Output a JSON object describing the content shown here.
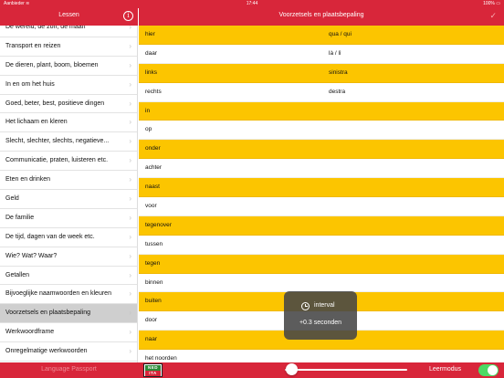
{
  "statusbar": {
    "carrier": "Aanbieder ≋",
    "time": "17:44",
    "battery": "100% ▭"
  },
  "sidebar": {
    "title": "Lessen",
    "info_icon": "info-icon",
    "items": [
      {
        "label": "De wereld, de zon, de maan",
        "active": false
      },
      {
        "label": "Transport en reizen",
        "active": false
      },
      {
        "label": "De dieren, plant, boom, bloemen",
        "active": false
      },
      {
        "label": "In en om het huis",
        "active": false
      },
      {
        "label": "Goed, beter, best, positieve dingen",
        "active": false
      },
      {
        "label": "Het lichaam en kleren",
        "active": false
      },
      {
        "label": "Slecht, slechter, slechts, negatieve...",
        "active": false
      },
      {
        "label": "Communicatie, praten, luisteren etc.",
        "active": false
      },
      {
        "label": "Eten en drinken",
        "active": false
      },
      {
        "label": "Geld",
        "active": false
      },
      {
        "label": "De familie",
        "active": false
      },
      {
        "label": "De tijd, dagen van de week etc.",
        "active": false
      },
      {
        "label": "Wie? Wat? Waar?",
        "active": false
      },
      {
        "label": "Getallen",
        "active": false
      },
      {
        "label": "Bijvoeglijke naamwoorden en kleuren",
        "active": false
      },
      {
        "label": "Voorzetsels en plaatsbepaling",
        "active": true
      },
      {
        "label": "Werkwoordframe",
        "active": false
      },
      {
        "label": "Onregelmatige werkwoorden",
        "active": false
      }
    ],
    "chevron": "›",
    "footer_link": "Language Passport"
  },
  "main": {
    "title": "Voorzetsels en plaatsbepaling",
    "check_icon": "✓",
    "rows": [
      {
        "dutch": "hier",
        "italian": "qua / qui",
        "highlight": true
      },
      {
        "dutch": "daar",
        "italian": "là / lì",
        "highlight": false
      },
      {
        "dutch": "links",
        "italian": "sinistra",
        "highlight": true
      },
      {
        "dutch": "rechts",
        "italian": "destra",
        "highlight": false
      },
      {
        "dutch": "in",
        "italian": "",
        "highlight": true
      },
      {
        "dutch": "op",
        "italian": "",
        "highlight": false
      },
      {
        "dutch": "onder",
        "italian": "",
        "highlight": true
      },
      {
        "dutch": "achter",
        "italian": "",
        "highlight": false
      },
      {
        "dutch": "naast",
        "italian": "",
        "highlight": true
      },
      {
        "dutch": "voor",
        "italian": "",
        "highlight": false
      },
      {
        "dutch": "tegenover",
        "italian": "",
        "highlight": true
      },
      {
        "dutch": "tussen",
        "italian": "",
        "highlight": false
      },
      {
        "dutch": "tegen",
        "italian": "",
        "highlight": true
      },
      {
        "dutch": "binnen",
        "italian": "",
        "highlight": false
      },
      {
        "dutch": "buiten",
        "italian": "",
        "highlight": true
      },
      {
        "dutch": "door",
        "italian": "",
        "highlight": false
      },
      {
        "dutch": "naar",
        "italian": "",
        "highlight": true
      },
      {
        "dutch": "het noorden",
        "italian": "",
        "highlight": false
      }
    ]
  },
  "toast": {
    "icon": "clock-icon",
    "title": "interval",
    "detail": "+0.3 seconden"
  },
  "bottombar": {
    "logo_top": "NED",
    "logo_bottom": "ITA",
    "slider_value": 0.0,
    "mode_label": "Leermodus",
    "mode_on": true
  },
  "colors": {
    "brand_red": "#d8263a",
    "highlight_yellow": "#fcc500",
    "toggle_green": "#4cd964"
  }
}
